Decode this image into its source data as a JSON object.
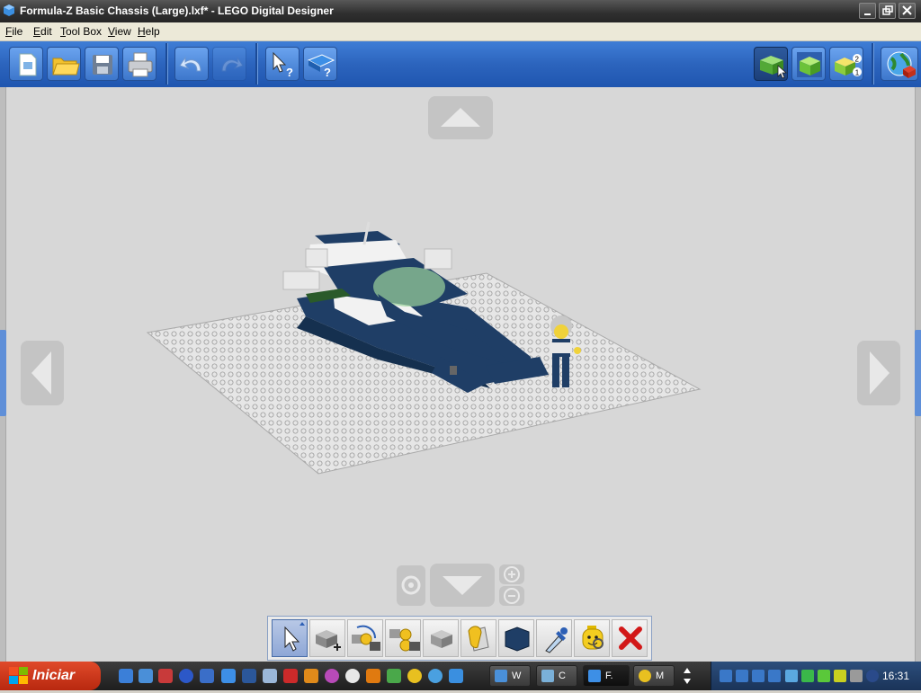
{
  "window": {
    "title": "Formula-Z Basic Chassis (Large).lxf* - LEGO Digital Designer"
  },
  "menu": {
    "items": [
      "File",
      "Edit",
      "Tool Box",
      "View",
      "Help"
    ]
  },
  "toolbar": {
    "buttons": [
      "new-file",
      "open-file",
      "save-file",
      "print",
      "undo",
      "redo",
      "help-tool",
      "help-book"
    ],
    "modes": [
      "build-mode",
      "view-mode",
      "building-guide-mode",
      "share-online"
    ]
  },
  "palette": {
    "tools": [
      "select-tool",
      "clone-tool",
      "hinge-tool",
      "hinge-align-tool",
      "flex-tool",
      "paint-tool",
      "color-swatch",
      "color-picker",
      "decoration-tool",
      "delete-tool"
    ],
    "active_color": "#1f3e66"
  },
  "taskbar": {
    "start_label": "Iniciar",
    "tasks": [
      "W",
      "C",
      "F.",
      "M"
    ],
    "clock": "16:31"
  },
  "colors": {
    "workspace": "#d7d7d7",
    "toolbar": "#2c64bd",
    "brick_blue": "#1f3e66"
  }
}
